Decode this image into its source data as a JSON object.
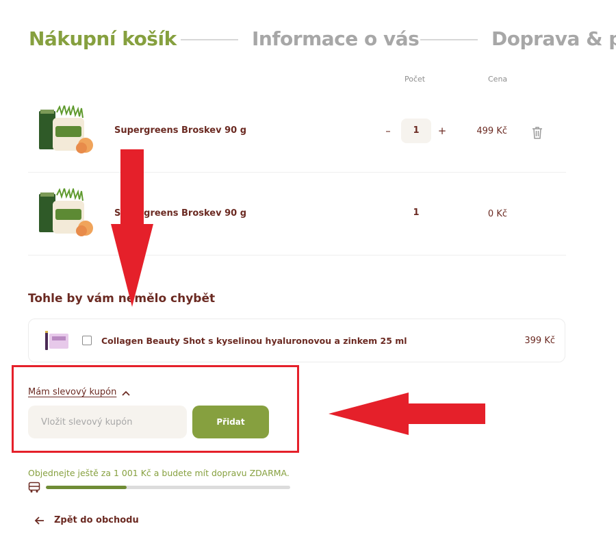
{
  "steps": [
    {
      "label": "Nákupní košík",
      "state": "active"
    },
    {
      "label": "Informace o vás",
      "state": "inactive"
    },
    {
      "label": "Doprava & pl",
      "state": "inactive"
    }
  ],
  "cart": {
    "columns": {
      "quantity": "Počet",
      "price": "Cena"
    },
    "items": [
      {
        "name": "Supergreens Broskev 90 g",
        "quantity": "1",
        "price": "499 Kč",
        "minus_symbol": "–",
        "plus_symbol": "+",
        "editable": true,
        "image_icon": "supergreens-product-image"
      },
      {
        "name": "Supergreens Broskev 90 g",
        "quantity": "1",
        "price": "0 Kč",
        "editable": false,
        "image_icon": "supergreens-product-image"
      }
    ]
  },
  "upsell": {
    "title": "Tohle by vám nemělo chybět",
    "item": {
      "name": "Collagen Beauty Shot s kyselinou hyaluronovou a zinkem 25 ml",
      "price": "399 Kč",
      "checked": false,
      "image_icon": "collagen-product-image"
    }
  },
  "coupon": {
    "toggle_label": "Mám slevový kupón",
    "expanded": true,
    "input_value": "",
    "placeholder": "Vložit slevový kupón",
    "submit_label": "Přidat"
  },
  "shipping": {
    "message": "Objednejte ještě za 1 001 Kč a budete mít dopravu ZDARMA.",
    "progress_fraction": 0.33,
    "icon": "bus-icon"
  },
  "back_link": {
    "label": "Zpět do obchodu",
    "icon": "arrow-left-icon"
  },
  "colors": {
    "accent": "#86a03f",
    "text": "#6b2a22",
    "muted": "#a7a7a7",
    "field_bg": "#f6f3ee",
    "annotation": "#e5202a"
  }
}
